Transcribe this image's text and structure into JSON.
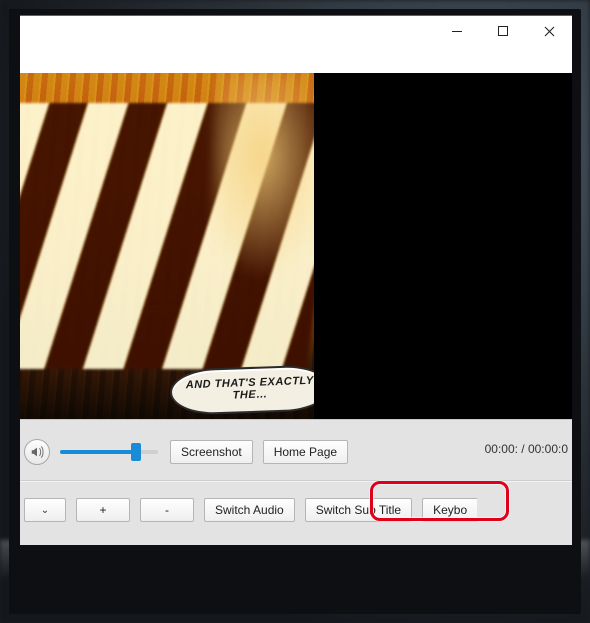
{
  "speech_text": "AND THAT'S EXACTLY THE…",
  "row1": {
    "screenshot": "Screenshot",
    "homepage": "Home Page"
  },
  "timecode": "00:00: / 00:00:0",
  "row2": {
    "plus": "+",
    "minus": "-",
    "switch_audio": "Switch Audio",
    "switch_subtitle": "Switch Sub Title",
    "keyboard": "Keybo"
  }
}
